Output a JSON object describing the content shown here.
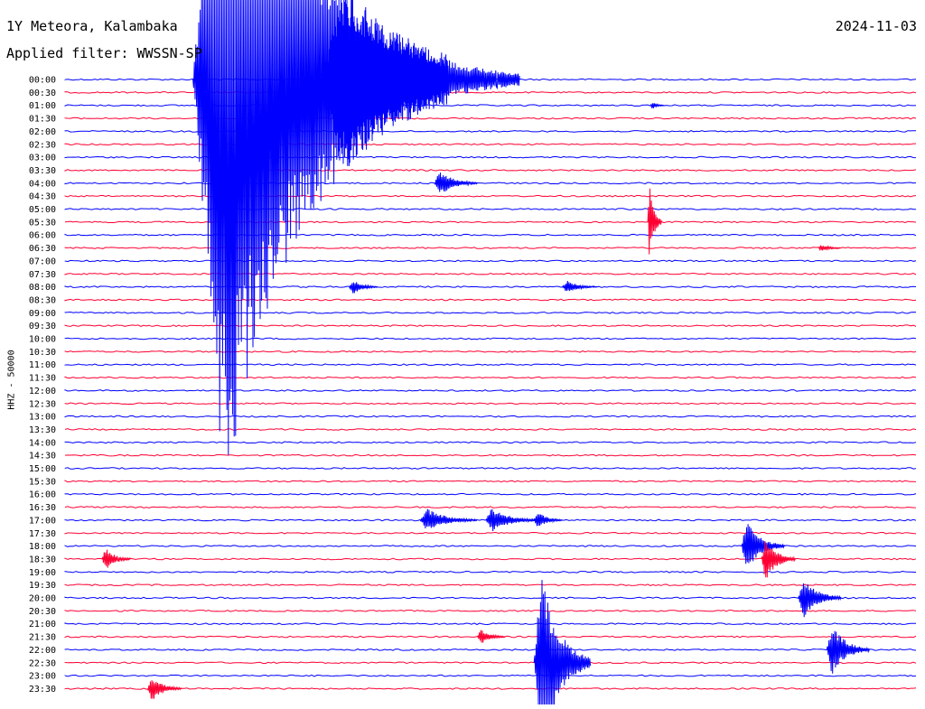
{
  "header": {
    "station": "1Y Meteora, Kalambaka",
    "filter": "Applied filter: WWSSN-SP",
    "date": "2024-11-03",
    "channel": "HHZ - 50000"
  },
  "colors": {
    "even_row": "#0000ff",
    "odd_row": "#ff0033",
    "background": "#ffffff"
  },
  "chart_data": {
    "type": "line",
    "title": "1Y Meteora, Kalambaka",
    "subtitle": "Applied filter: WWSSN-SP",
    "date": "2024-11-03",
    "ylabel": "HHZ - 50000",
    "xlabel": "",
    "row_minutes": 30,
    "row_labels": [
      "00:00",
      "00:30",
      "01:00",
      "01:30",
      "02:00",
      "02:30",
      "03:00",
      "03:30",
      "04:00",
      "04:30",
      "05:00",
      "05:30",
      "06:00",
      "06:30",
      "07:00",
      "07:30",
      "08:00",
      "08:30",
      "09:00",
      "09:30",
      "10:00",
      "10:30",
      "11:00",
      "11:30",
      "12:00",
      "12:30",
      "13:00",
      "13:30",
      "14:00",
      "14:30",
      "15:00",
      "15:30",
      "16:00",
      "16:30",
      "17:00",
      "17:30",
      "18:00",
      "18:30",
      "19:00",
      "19:30",
      "20:00",
      "20:30",
      "21:00",
      "21:30",
      "22:00",
      "22:30",
      "23:00",
      "23:30"
    ],
    "events": [
      {
        "row": 0,
        "start_min": 4.5,
        "duration_min": 9,
        "peak_rows": 32,
        "color": "blue"
      },
      {
        "row": 0,
        "start_min": 9.0,
        "duration_min": 7,
        "peak_rows": 8,
        "color": "blue"
      },
      {
        "row": 2,
        "start_min": 20.6,
        "duration_min": 0.5,
        "peak_rows": 0.3,
        "color": "blue"
      },
      {
        "row": 8,
        "start_min": 13.0,
        "duration_min": 1.5,
        "peak_rows": 1.0,
        "color": "blue"
      },
      {
        "row": 11,
        "start_min": 20.5,
        "duration_min": 0.5,
        "peak_rows": 3.0,
        "color": "red"
      },
      {
        "row": 13,
        "start_min": 26.5,
        "duration_min": 0.8,
        "peak_rows": 0.3,
        "color": "red"
      },
      {
        "row": 16,
        "start_min": 10.0,
        "duration_min": 1.0,
        "peak_rows": 0.6,
        "color": "blue"
      },
      {
        "row": 16,
        "start_min": 17.5,
        "duration_min": 1.2,
        "peak_rows": 0.5,
        "color": "blue"
      },
      {
        "row": 34,
        "start_min": 12.5,
        "duration_min": 2.0,
        "peak_rows": 0.9,
        "color": "blue"
      },
      {
        "row": 34,
        "start_min": 14.8,
        "duration_min": 1.8,
        "peak_rows": 1.0,
        "color": "blue"
      },
      {
        "row": 34,
        "start_min": 16.5,
        "duration_min": 1.0,
        "peak_rows": 0.7,
        "color": "blue"
      },
      {
        "row": 36,
        "start_min": 23.8,
        "duration_min": 1.5,
        "peak_rows": 2.0,
        "color": "blue"
      },
      {
        "row": 37,
        "start_min": 24.5,
        "duration_min": 1.2,
        "peak_rows": 1.7,
        "color": "red"
      },
      {
        "row": 37,
        "start_min": 1.3,
        "duration_min": 1.0,
        "peak_rows": 0.9,
        "color": "red"
      },
      {
        "row": 40,
        "start_min": 25.8,
        "duration_min": 1.5,
        "peak_rows": 1.6,
        "color": "blue"
      },
      {
        "row": 43,
        "start_min": 14.5,
        "duration_min": 1.0,
        "peak_rows": 0.6,
        "color": "red"
      },
      {
        "row": 44,
        "start_min": 26.8,
        "duration_min": 1.5,
        "peak_rows": 2.0,
        "color": "blue"
      },
      {
        "row": 45,
        "start_min": 16.5,
        "duration_min": 2.0,
        "peak_rows": 7.0,
        "color": "blue"
      },
      {
        "row": 47,
        "start_min": 2.9,
        "duration_min": 1.2,
        "peak_rows": 1.0,
        "color": "red"
      }
    ]
  }
}
